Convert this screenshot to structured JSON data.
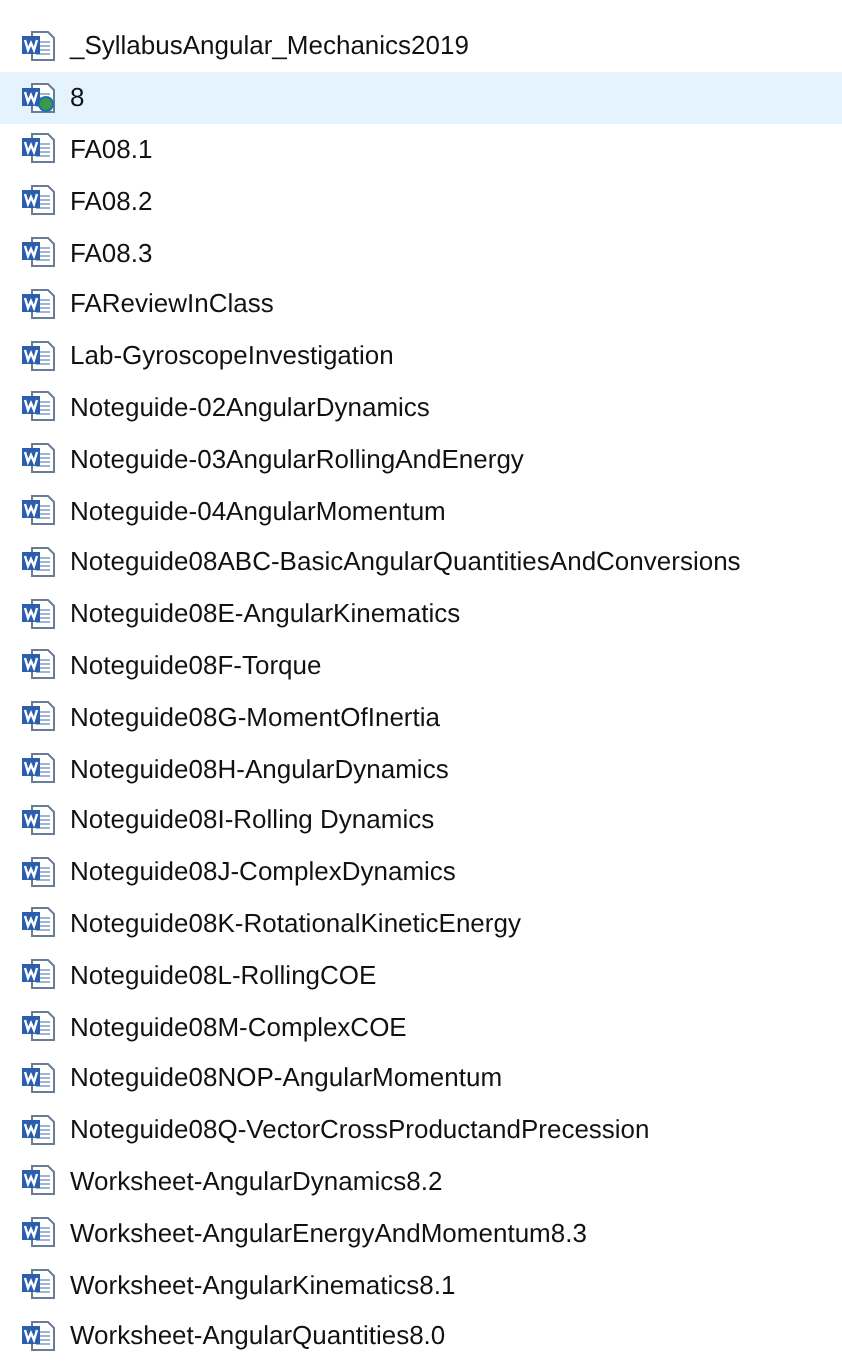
{
  "files": [
    {
      "name": "_SyllabusAngular_Mechanics2019",
      "kind": "doc",
      "selected": false
    },
    {
      "name": "8",
      "kind": "web",
      "selected": true
    },
    {
      "name": "FA08.1",
      "kind": "doc",
      "selected": false
    },
    {
      "name": "FA08.2",
      "kind": "doc",
      "selected": false
    },
    {
      "name": "FA08.3",
      "kind": "doc",
      "selected": false
    },
    {
      "name": "FAReviewInClass",
      "kind": "doc",
      "selected": false
    },
    {
      "name": "Lab-GyroscopeInvestigation",
      "kind": "doc",
      "selected": false
    },
    {
      "name": "Noteguide-02AngularDynamics",
      "kind": "doc",
      "selected": false
    },
    {
      "name": "Noteguide-03AngularRollingAndEnergy",
      "kind": "doc",
      "selected": false
    },
    {
      "name": "Noteguide-04AngularMomentum",
      "kind": "doc",
      "selected": false
    },
    {
      "name": "Noteguide08ABC-BasicAngularQuantitiesAndConversions",
      "kind": "doc",
      "selected": false
    },
    {
      "name": "Noteguide08E-AngularKinematics",
      "kind": "doc",
      "selected": false
    },
    {
      "name": "Noteguide08F-Torque",
      "kind": "doc",
      "selected": false
    },
    {
      "name": "Noteguide08G-MomentOfInertia",
      "kind": "doc",
      "selected": false
    },
    {
      "name": "Noteguide08H-AngularDynamics",
      "kind": "doc",
      "selected": false
    },
    {
      "name": "Noteguide08I-Rolling Dynamics",
      "kind": "doc",
      "selected": false
    },
    {
      "name": "Noteguide08J-ComplexDynamics",
      "kind": "doc",
      "selected": false
    },
    {
      "name": "Noteguide08K-RotationalKineticEnergy",
      "kind": "doc",
      "selected": false
    },
    {
      "name": "Noteguide08L-RollingCOE",
      "kind": "doc",
      "selected": false
    },
    {
      "name": "Noteguide08M-ComplexCOE",
      "kind": "doc",
      "selected": false
    },
    {
      "name": "Noteguide08NOP-AngularMomentum",
      "kind": "doc",
      "selected": false
    },
    {
      "name": "Noteguide08Q-VectorCrossProductandPrecession",
      "kind": "doc",
      "selected": false
    },
    {
      "name": "Worksheet-AngularDynamics8.2",
      "kind": "doc",
      "selected": false
    },
    {
      "name": "Worksheet-AngularEnergyAndMomentum8.3",
      "kind": "doc",
      "selected": false
    },
    {
      "name": "Worksheet-AngularKinematics8.1",
      "kind": "doc",
      "selected": false
    },
    {
      "name": "Worksheet-AngularQuantities8.0",
      "kind": "doc",
      "selected": false
    }
  ]
}
